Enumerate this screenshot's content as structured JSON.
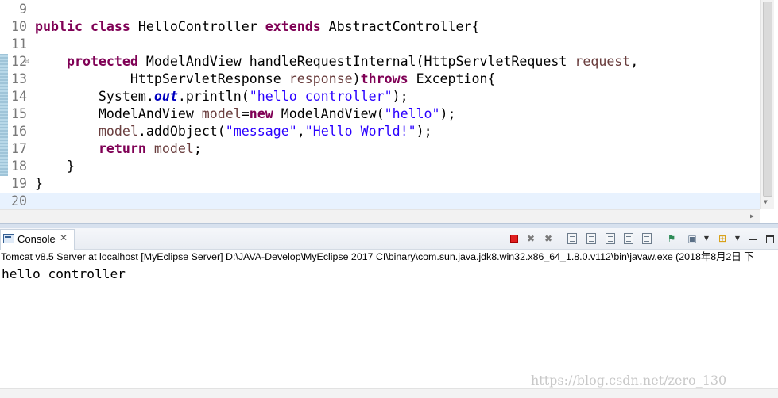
{
  "editor": {
    "lines": [
      {
        "no": "9",
        "tokens": []
      },
      {
        "no": "10",
        "tokens": [
          {
            "t": "public",
            "c": "kw"
          },
          {
            "t": " "
          },
          {
            "t": "class",
            "c": "kw"
          },
          {
            "t": " HelloController "
          },
          {
            "t": "extends",
            "c": "kw"
          },
          {
            "t": " AbstractController{"
          }
        ]
      },
      {
        "no": "11",
        "tokens": []
      },
      {
        "no": "12",
        "fold": true,
        "tokens": [
          {
            "t": "    "
          },
          {
            "t": "protected",
            "c": "kw"
          },
          {
            "t": " ModelAndView handleRequestInternal(HttpServletRequest "
          },
          {
            "t": "request",
            "c": "param"
          },
          {
            "t": ","
          }
        ]
      },
      {
        "no": "13",
        "tokens": [
          {
            "t": "            HttpServletResponse "
          },
          {
            "t": "response",
            "c": "param"
          },
          {
            "t": ")"
          },
          {
            "t": "throws",
            "c": "kw"
          },
          {
            "t": " Exception{"
          }
        ]
      },
      {
        "no": "14",
        "tokens": [
          {
            "t": "        System."
          },
          {
            "t": "out",
            "c": "static"
          },
          {
            "t": ".println("
          },
          {
            "t": "\"hello controller\"",
            "c": "str"
          },
          {
            "t": ");"
          }
        ]
      },
      {
        "no": "15",
        "tokens": [
          {
            "t": "        ModelAndView "
          },
          {
            "t": "model",
            "c": "param"
          },
          {
            "t": "="
          },
          {
            "t": "new",
            "c": "kw"
          },
          {
            "t": " ModelAndView("
          },
          {
            "t": "\"hello\"",
            "c": "str"
          },
          {
            "t": ");"
          }
        ]
      },
      {
        "no": "16",
        "tokens": [
          {
            "t": "        "
          },
          {
            "t": "model",
            "c": "param"
          },
          {
            "t": ".addObject("
          },
          {
            "t": "\"message\"",
            "c": "str"
          },
          {
            "t": ","
          },
          {
            "t": "\"Hello World!\"",
            "c": "str"
          },
          {
            "t": ");"
          }
        ]
      },
      {
        "no": "17",
        "tokens": [
          {
            "t": "        "
          },
          {
            "t": "return",
            "c": "kw"
          },
          {
            "t": " "
          },
          {
            "t": "model",
            "c": "param"
          },
          {
            "t": ";"
          }
        ]
      },
      {
        "no": "18",
        "tokens": [
          {
            "t": "    }"
          }
        ]
      },
      {
        "no": "19",
        "tokens": [
          {
            "t": "}"
          }
        ]
      },
      {
        "no": "20",
        "current": true,
        "tokens": []
      }
    ]
  },
  "console": {
    "tab_label": "Console",
    "tab_close": "✕",
    "process_label": "Tomcat v8.5 Server at localhost [MyEclipse Server] D:\\JAVA-Develop\\MyEclipse 2017 CI\\binary\\com.sun.java.jdk8.win32.x86_64_1.8.0.v112\\bin\\javaw.exe (2018年8月2日 下",
    "output": "hello controller",
    "watermark": "https://blog.csdn.net/zero_130"
  },
  "icons": {
    "fold": "collapse-icon",
    "remove_launch": "✖",
    "remove_all": "✖",
    "pin": "⚑",
    "display": "▣",
    "open": "⊞",
    "dropdown": "▼",
    "scroll_down": "▼",
    "scroll_right": "▶"
  }
}
